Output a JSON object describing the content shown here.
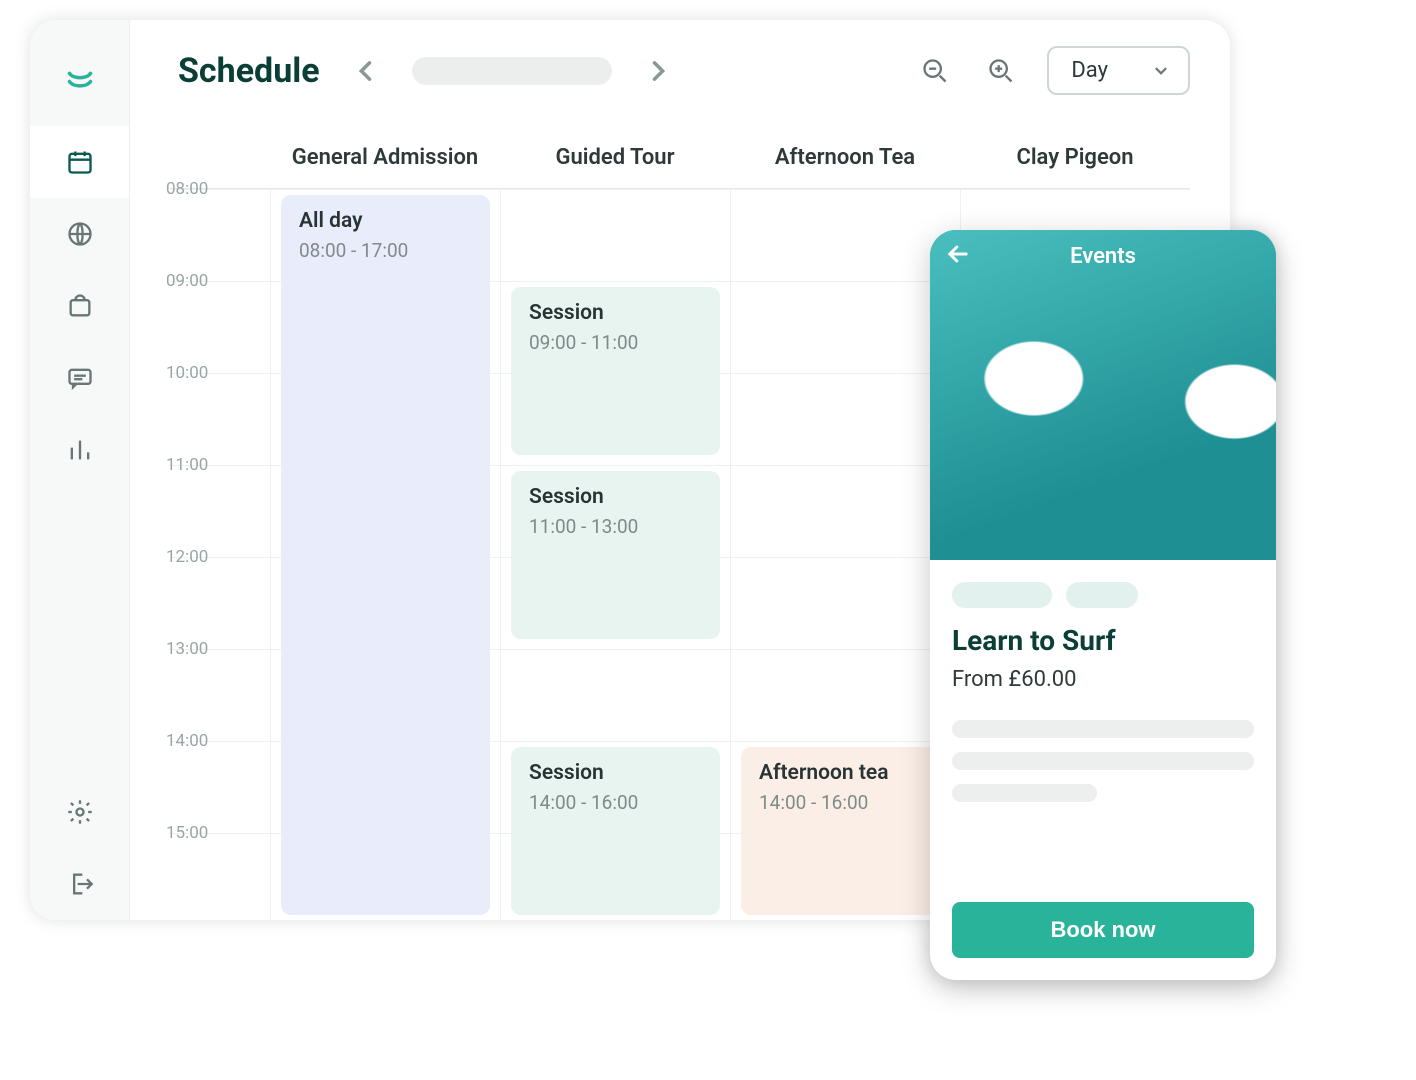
{
  "header": {
    "title": "Schedule"
  },
  "view": {
    "selected": "Day"
  },
  "columns": [
    "General Admission",
    "Guided Tour",
    "Afternoon Tea",
    "Clay Pigeon"
  ],
  "hours": [
    "08:00",
    "09:00",
    "10:00",
    "11:00",
    "12:00",
    "13:00",
    "14:00",
    "15:00"
  ],
  "events": {
    "allday": {
      "label": "All day",
      "time": "08:00 - 17:00"
    },
    "g1": {
      "label": "Session",
      "time": "09:00 - 11:00"
    },
    "g2": {
      "label": "Session",
      "time": "11:00 - 13:00"
    },
    "g3": {
      "label": "Session",
      "time": "14:00 - 16:00"
    },
    "tea": {
      "label": "Afternoon tea",
      "time": "14:00 - 16:00"
    }
  },
  "mobile": {
    "header": "Events",
    "title": "Learn to Surf",
    "price": "From £60.00",
    "cta": "Book now"
  }
}
